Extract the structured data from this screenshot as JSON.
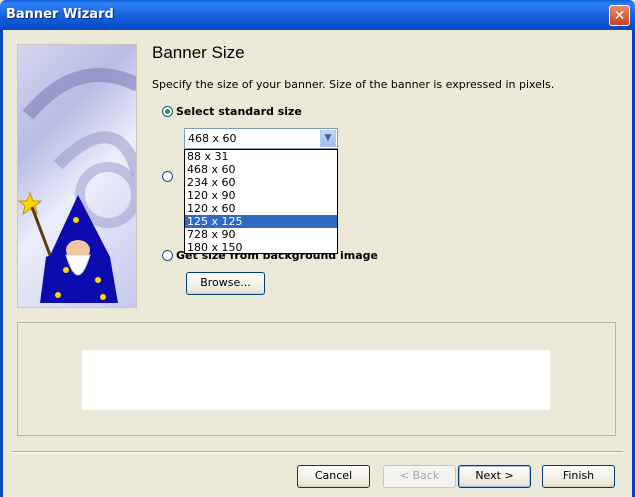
{
  "window": {
    "title": "Banner Wizard",
    "close_glyph": "✕"
  },
  "page": {
    "heading": "Banner Size",
    "description": "Specify the size of your banner. Size of the banner is expressed in pixels."
  },
  "options": {
    "standard_label": "Select standard size",
    "background_label": "Get size from background image"
  },
  "combo": {
    "selected_value": "468 x 60",
    "arrow_glyph": "▼",
    "items": [
      "88 x 31",
      "468 x 60",
      "234 x 60",
      "120 x 90",
      "120 x 60",
      "125 x 125",
      "728 x 90",
      "180 x 150"
    ],
    "highlighted_item": "125 x 125"
  },
  "buttons": {
    "browse": "Browse...",
    "cancel": "Cancel",
    "back": "< Back",
    "next": "Next >",
    "finish": "Finish"
  },
  "colors": {
    "title_bar": "#0a5fd8",
    "dialog_bg": "#ece9d8",
    "selection": "#316ac5"
  }
}
